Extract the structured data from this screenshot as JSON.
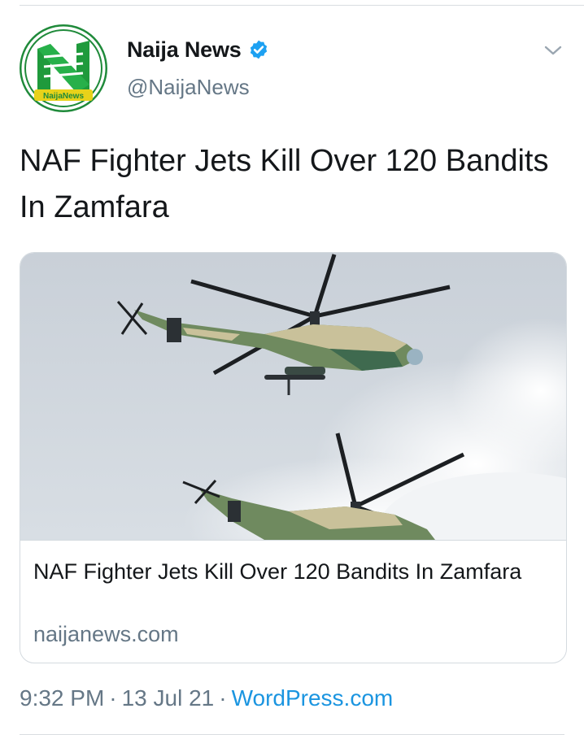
{
  "author": {
    "display_name": "Naija News",
    "handle": "@NaijaNews",
    "verified": true,
    "avatar_icon": "naija-news-logo",
    "avatar_text": "NaijaNews"
  },
  "tweet": {
    "text": "NAF Fighter Jets Kill Over 120 Bandits In Zamfara"
  },
  "card": {
    "image_description_icon": "helicopters-image",
    "title": "NAF Fighter Jets Kill Over 120 Bandits In Zamfara",
    "domain": "naijanews.com"
  },
  "meta": {
    "time": "9:32 PM",
    "separator": "·",
    "date": "13 Jul 21",
    "source": "WordPress.com"
  },
  "colors": {
    "link": "#1b95e0",
    "muted": "#657786",
    "verified": "#1da1f2",
    "logo_green": "#1f8a3a"
  }
}
